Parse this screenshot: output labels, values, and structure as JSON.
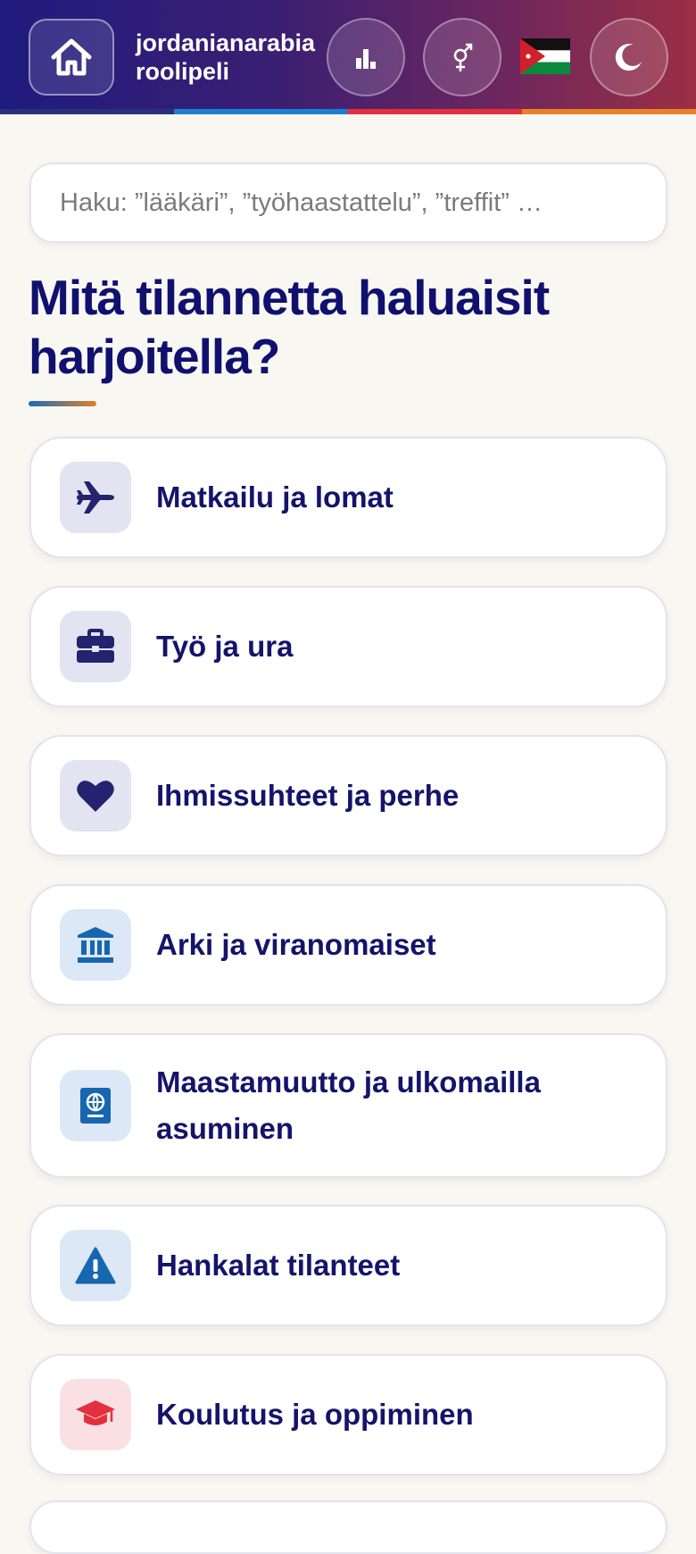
{
  "header": {
    "brand_line1": "jordanianarabia",
    "brand_line2": "roolipeli",
    "icons": [
      "home-icon",
      "bar-chart-icon",
      "gender-icon",
      "jordan-flag-icon",
      "moon-icon"
    ],
    "accent_colors": [
      "#2a2f7a",
      "#1e7fd0",
      "#e3303d",
      "#e8822a"
    ]
  },
  "search": {
    "placeholder": "Haku: ”lääkäri”, ”työhaastattelu”, ”treffit” …"
  },
  "main": {
    "title": "Mitä tilannetta haluaisit harjoitella?",
    "categories": [
      {
        "label": "Matkailu ja lomat",
        "icon": "airplane-icon",
        "color": "#23236f"
      },
      {
        "label": "Työ ja ura",
        "icon": "briefcase-icon",
        "color": "#23236f"
      },
      {
        "label": "Ihmissuhteet ja perhe",
        "icon": "heart-icon",
        "color": "#23236f"
      },
      {
        "label": "Arki ja viranomaiset",
        "icon": "bank-icon",
        "color": "#1766b0"
      },
      {
        "label": "Maastamuutto ja ulkomailla asuminen",
        "icon": "passport-icon",
        "color": "#1766b0"
      },
      {
        "label": "Hankalat tilanteet",
        "icon": "warning-icon",
        "color": "#1766b0"
      },
      {
        "label": "Koulutus ja oppiminen",
        "icon": "graduation-cap-icon",
        "color": "#e3303d"
      }
    ]
  }
}
